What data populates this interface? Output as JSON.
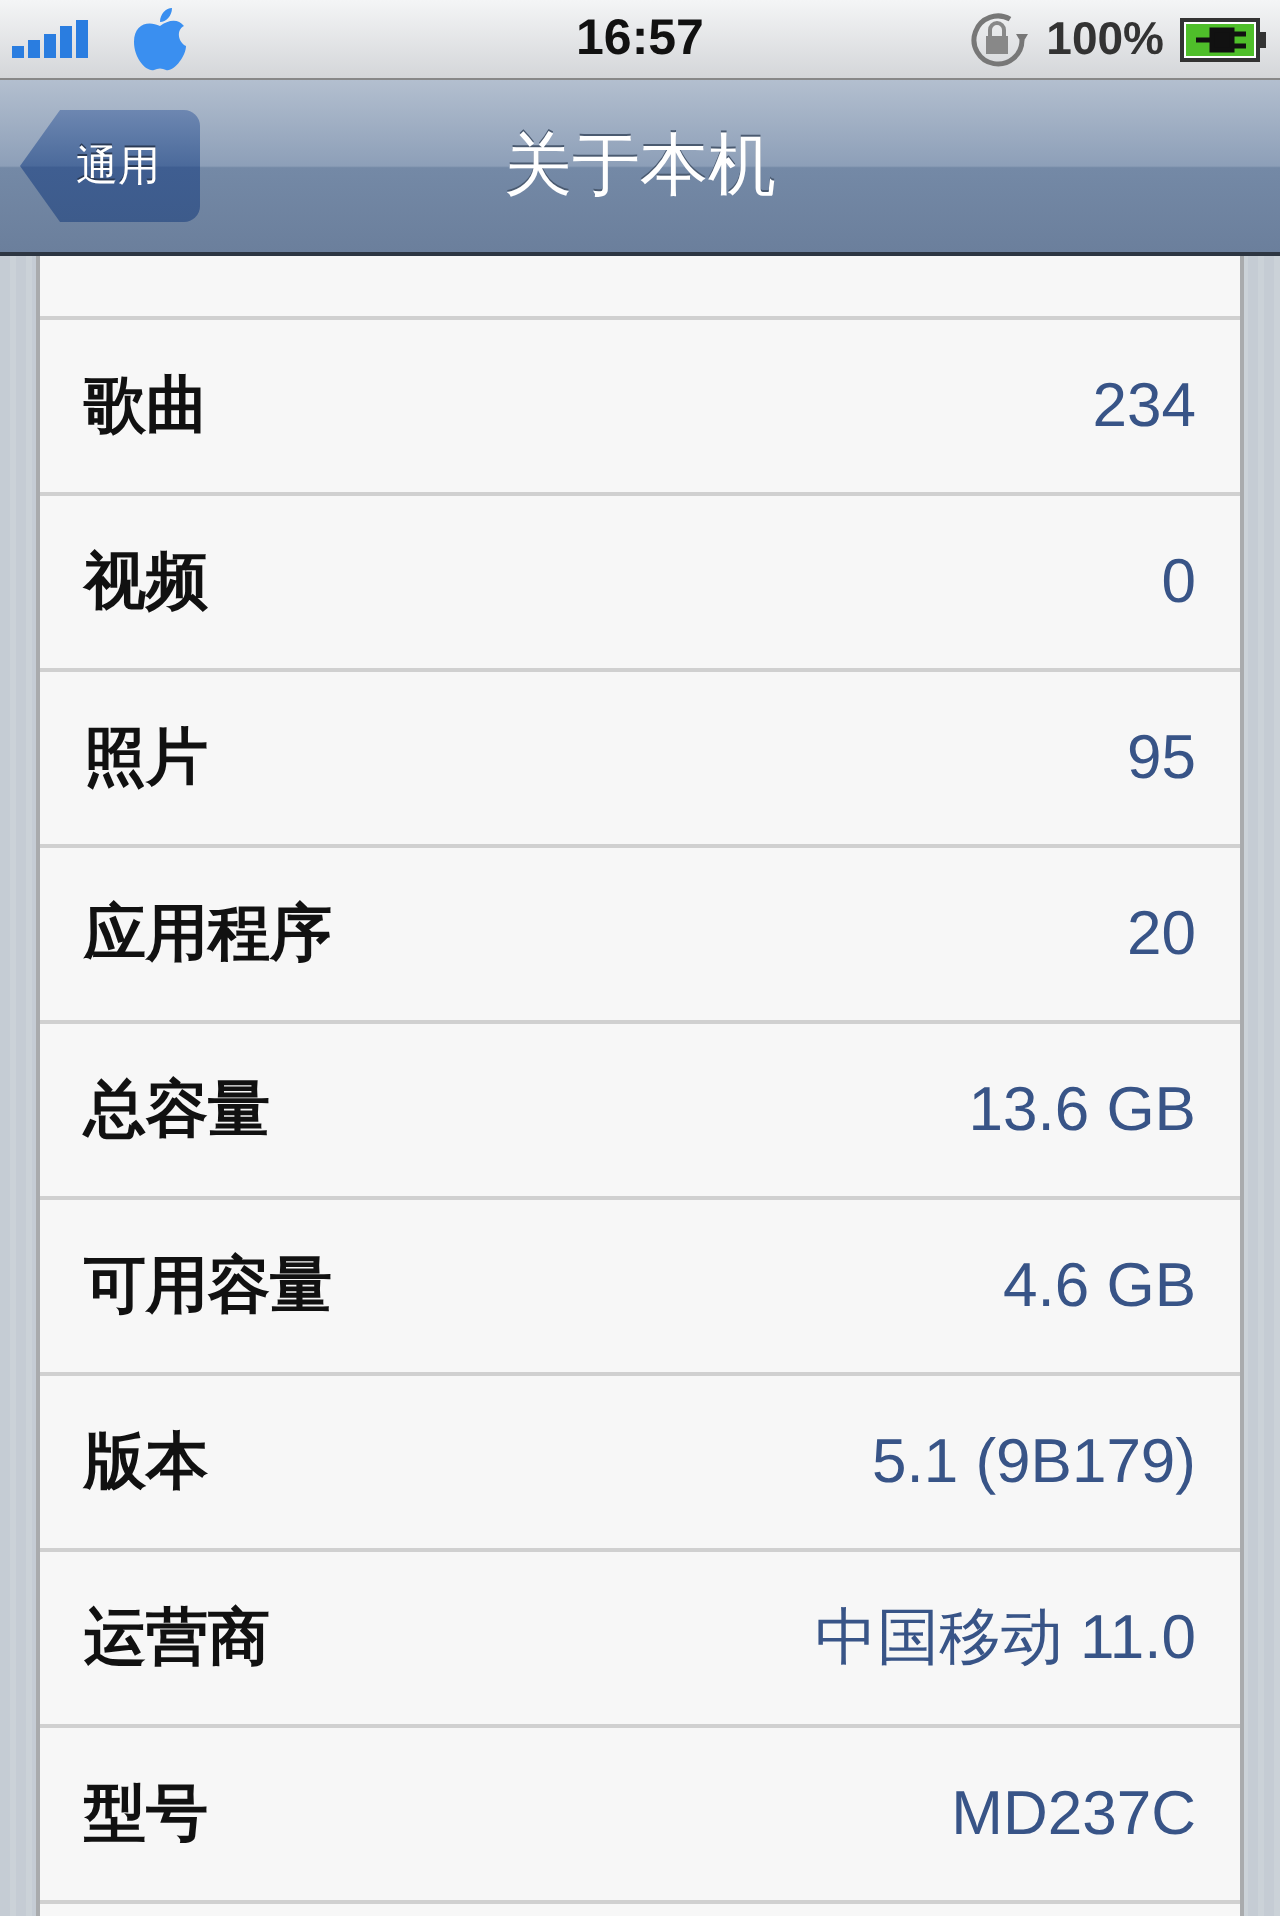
{
  "status_bar": {
    "time": "16:57",
    "battery": "100%"
  },
  "nav_bar": {
    "back": "通用",
    "title": "关于本机"
  },
  "rows": [
    {
      "label": "歌曲",
      "value": "234"
    },
    {
      "label": "视频",
      "value": "0"
    },
    {
      "label": "照片",
      "value": "95"
    },
    {
      "label": "应用程序",
      "value": "20"
    },
    {
      "label": "总容量",
      "value": "13.6 GB"
    },
    {
      "label": "可用容量",
      "value": "4.6 GB"
    },
    {
      "label": "版本",
      "value": "5.1 (9B179)"
    },
    {
      "label": "运营商",
      "value": "中国移动 11.0"
    },
    {
      "label": "型号",
      "value": "MD237C"
    }
  ]
}
